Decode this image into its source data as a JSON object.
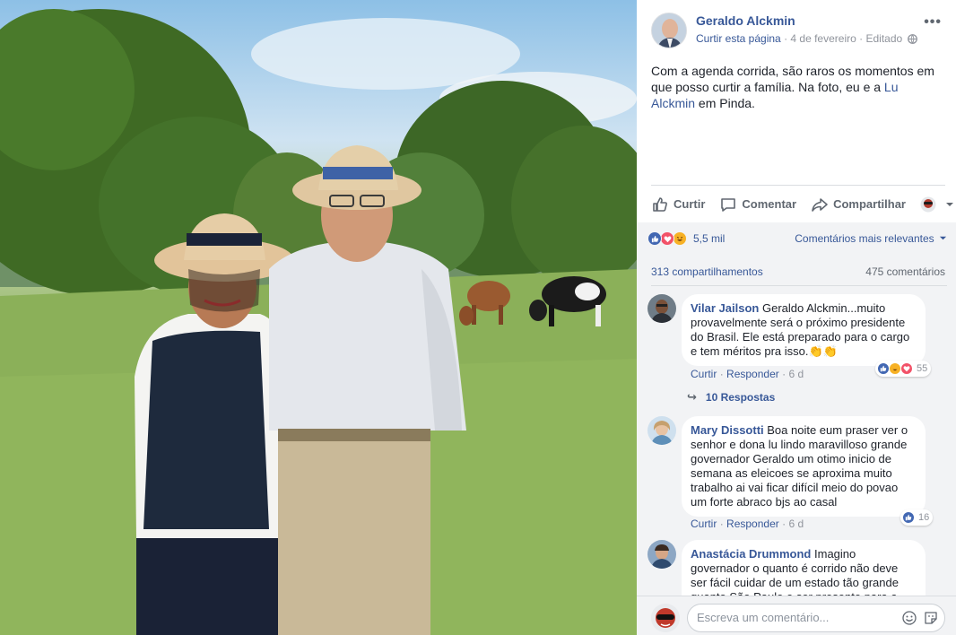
{
  "post": {
    "page_name": "Geraldo Alckmin",
    "like_page": "Curtir esta página",
    "date": "4 de fevereiro",
    "edited": "Editado",
    "caption_text": "Com a agenda corrida, são raros os momentos em que posso curtir a família. Na foto, eu e a ",
    "caption_mention": "Lu Alckmin",
    "caption_end": " em Pinda."
  },
  "actions": {
    "like": "Curtir",
    "comment": "Comentar",
    "share": "Compartilhar"
  },
  "stats": {
    "reactions": "5,5 mil",
    "sort": "Comentários mais relevantes",
    "shares": "313 compartilhamentos",
    "comments": "475 comentários"
  },
  "comments": [
    {
      "author": "Vilar Jailson",
      "text": "Geraldo Alckmin...muito provavelmente será o próximo presidente do Brasil. Ele está preparado para o cargo e tem méritos pra isso.",
      "like": "Curtir",
      "reply": "Responder",
      "time": "6 d",
      "reaction_count": "55",
      "replies": "10 Respostas"
    },
    {
      "author": "Mary Dissotti",
      "text": "Boa noite eum praser ver o senhor e dona lu lindo maravilloso grande governador Geraldo um otimo inicio de semana as eleicoes se aproxima muito trabalho ai vai ficar difícil meio do povao um forte abraco bjs ao casal",
      "like": "Curtir",
      "reply": "Responder",
      "time": "6 d",
      "reaction_count": "16"
    },
    {
      "author": "Anastácia Drummond",
      "text": "Imagino governador o quanto é corrido não deve ser fácil cuidar de um estado tão grande quanto São Paulo e ser presente para a família"
    }
  ],
  "composer": {
    "placeholder": "Escreva um comentário..."
  },
  "colors": {
    "link": "#385898",
    "like_blue": "#4267b2",
    "love_red": "#f25268",
    "haha_yellow": "#f7b125"
  }
}
